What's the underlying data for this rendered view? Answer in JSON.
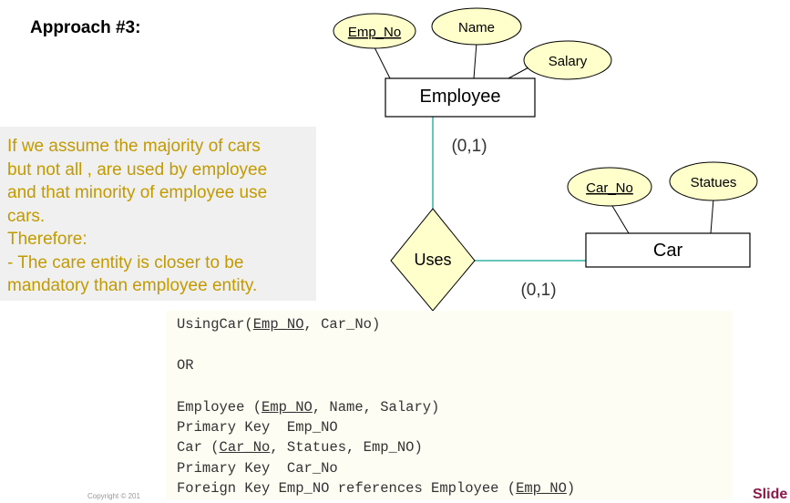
{
  "title": "Approach #3:",
  "note": {
    "lines": [
      "If we assume the majority of cars",
      "but not all , are used by employee",
      "and that minority of employee use",
      "cars.",
      "Therefore:",
      "- The care entity is closer to be",
      "mandatory than employee entity."
    ]
  },
  "diagram": {
    "employee": {
      "entity": "Employee",
      "attributes": {
        "key": "Emp_No",
        "name": "Name",
        "salary": "Salary"
      }
    },
    "car": {
      "entity": "Car",
      "attributes": {
        "key": "Car_No",
        "statues": "Statues"
      }
    },
    "relationship": "Uses",
    "employee_cardinality": "(0,1)",
    "car_cardinality": "(0,1)",
    "colors": {
      "link": "#33b3a6",
      "attribute_fill": "#ffffcc",
      "diamond_fill": "#ffffcc"
    }
  },
  "schema": {
    "line1_pre": "UsingCar(",
    "line1_key": "Emp_NO",
    "line1_post": ", Car_No)",
    "or": "OR",
    "line3_pre": "Employee (",
    "line3_key": "Emp_NO",
    "line3_post": ", Name, Salary)",
    "line4": "Primary Key  Emp_NO",
    "line5_pre": "Car (",
    "line5_key": "Car_No",
    "line5_post": ", Statues, Emp_NO)",
    "line6": "Primary Key  Car_No",
    "line7_pre": "Foreign Key Emp_NO references Employee (",
    "line7_key": "Emp_NO",
    "line7_post": ")"
  },
  "footer": {
    "left": "Copyright © 201",
    "right": "Slide"
  }
}
